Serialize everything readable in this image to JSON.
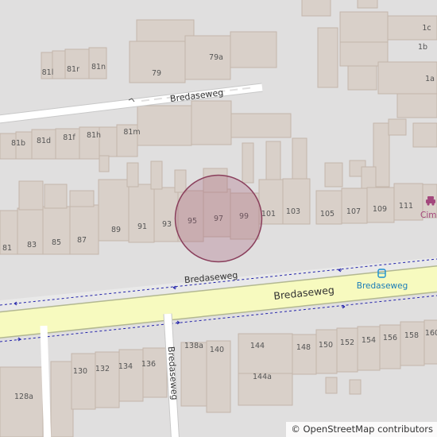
{
  "streets": {
    "top": "Bredaseweg",
    "service": "Bredaseweg",
    "main": "Bredaseweg",
    "side": "Bredaseweg"
  },
  "house_numbers": [
    "1c",
    "1b",
    "1a",
    "79a",
    "79",
    "81n",
    "81l",
    "81r",
    "81m",
    "81h",
    "81f",
    "81d",
    "81b",
    "81",
    "83",
    "85",
    "87",
    "89",
    "91",
    "93",
    "95",
    "97",
    "99",
    "101",
    "103",
    "105",
    "107",
    "109",
    "111",
    "128a",
    "130",
    "132",
    "134",
    "136",
    "138a",
    "140",
    "144",
    "144a",
    "148",
    "150",
    "152",
    "154",
    "156",
    "158",
    "160"
  ],
  "bus_stop": {
    "label": "Bredaseweg",
    "icon": "bus-stop-icon"
  },
  "poi": {
    "label": "Cime",
    "icon": "car-repair-icon"
  },
  "marker": {
    "shape": "circle",
    "color": "#a0526e"
  },
  "colors": {
    "background": "#e0dfdf",
    "building": "#d9d0c9",
    "building_outline": "#c4b6ab",
    "primary_road": "#f7fabf",
    "primary_casing": "#b3b891",
    "bus_route": "#2222aa",
    "poi": "#a3477c"
  },
  "attribution": "© OpenStreetMap contributors"
}
